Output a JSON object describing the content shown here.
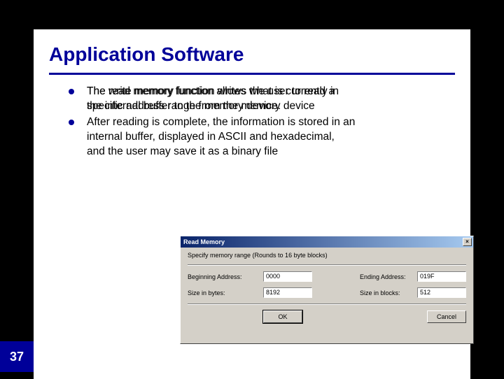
{
  "page_number": "37",
  "title": "Application Software",
  "bullets": {
    "b1_line1": "The read memory function allows the user to read a",
    "b1_line2": "specific address range from the memory device",
    "b1_overlay_line1": "The write memory function writes what is currently in",
    "b1_overlay_line2": "the internal buffer to the memory device.",
    "b2_line1": "After reading is complete, the information is stored in an",
    "b2_line2": "internal buffer, displayed in ASCII and hexadecimal,",
    "b2_line3": "and the user may save it as a binary file"
  },
  "dialog": {
    "title": "Read Memory",
    "instruction": "Specify memory range (Rounds to 16 byte blocks)",
    "labels": {
      "begin": "Beginning Address:",
      "end": "Ending Address:",
      "sizeBytes": "Size in bytes:",
      "sizeBlocks": "Size in blocks:"
    },
    "values": {
      "begin": "0000",
      "end": "019F",
      "sizeBytes": "8192",
      "sizeBlocks": "512"
    },
    "buttons": {
      "ok": "OK",
      "cancel": "Cancel"
    }
  }
}
